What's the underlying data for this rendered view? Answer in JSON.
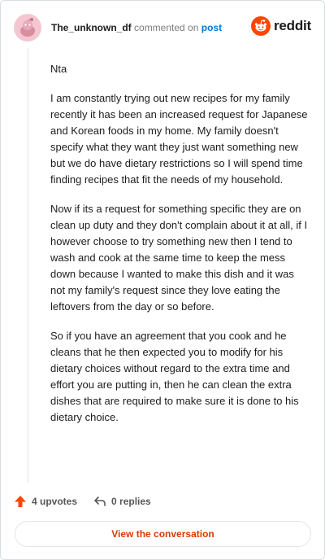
{
  "header": {
    "username": "The_unknown_df",
    "action_text": "commented on",
    "post_link": "post",
    "brand": "reddit"
  },
  "comment": {
    "paragraphs": [
      "Nta",
      "I am constantly trying out new recipes for my family recently it has been an increased request for Japanese and Korean foods in my home. My family doesn't specify what they want they just want something new but we do have dietary restrictions so I will spend time finding recipes that fit the needs of my household.",
      "Now if its a request for something specific they are on clean up duty and they don't complain about it at all, if I however choose to try something new then I tend to wash and cook at the same time to keep the mess down because I wanted to make this dish and it was not my family's request since they love eating the leftovers from the day or so before.",
      "So if you have an agreement that you cook and he cleans that he then expected you to modify for his dietary choices without regard to the extra time and effort you are putting in, then he can clean the extra dishes that are required to make sure it is done to his dietary choice."
    ]
  },
  "actions": {
    "upvotes": "4 upvotes",
    "replies": "0 replies"
  },
  "footer": {
    "view_button": "View the conversation"
  },
  "colors": {
    "accent": "#d93a00",
    "upvote": "#ff4500",
    "link": "#0079d3"
  }
}
